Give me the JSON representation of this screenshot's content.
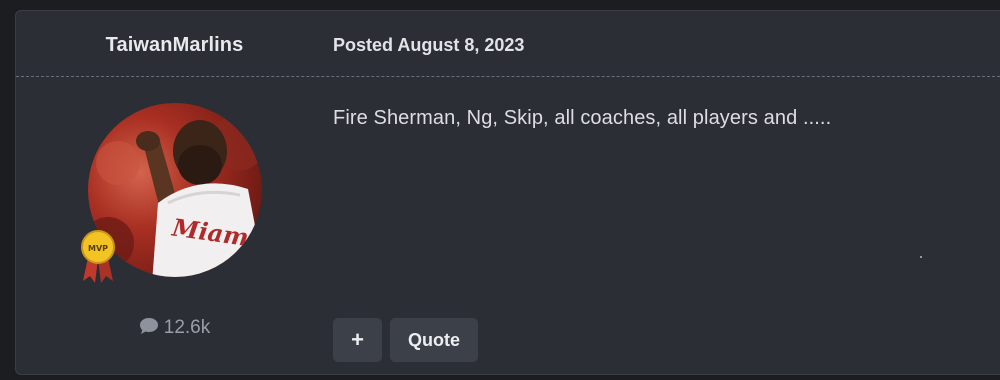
{
  "post": {
    "author": "TaiwanMarlins",
    "posted": "Posted August 8, 2023",
    "body": "Fire Sherman, Ng, Skip, all coaches, all players and .....",
    "author_post_count": "12.6k",
    "author_badge": "MVP",
    "avatar_jersey_text": "Miami",
    "actions": {
      "plus_label": "+",
      "quote_label": "Quote"
    }
  },
  "icons": {
    "post_count": "comment-bubble-icon",
    "badge": "mvp-ribbon-icon"
  },
  "colors": {
    "page_background": "#1c1d20",
    "card_background": "#2b2e35",
    "button_background": "#3c4048",
    "badge_gold": "#f2c322",
    "badge_ribbon": "#c0392b"
  }
}
